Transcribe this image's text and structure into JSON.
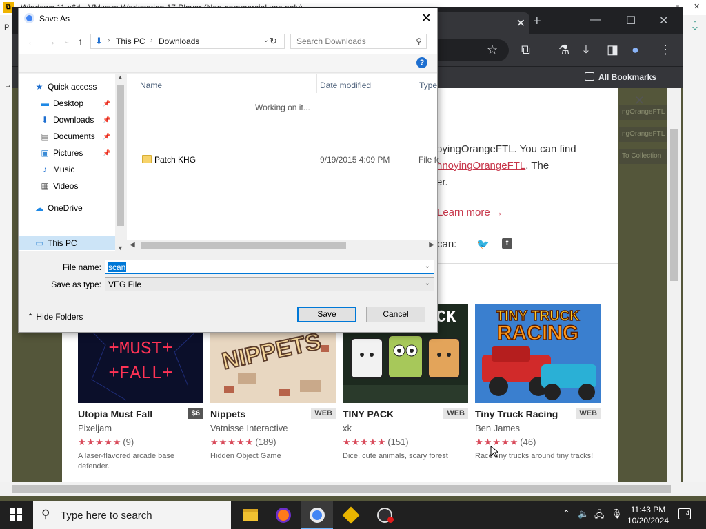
{
  "vm": {
    "title": "Windows 11 x64 - VMware Workstation 17 Player (Non-commercial use only)"
  },
  "browser": {
    "tab_label": "h",
    "bookmarks_label": "All Bookmarks",
    "side_tags": [
      "ngOrangeFTL",
      "ngOrangeFTL",
      "To Collection"
    ]
  },
  "page": {
    "popup_lines": [
      "oyingOrangeFTL. You can find",
      "nnoyingOrangeFTL",
      ". The",
      "er."
    ],
    "learn_more": "Learn more →",
    "share_label": "can:"
  },
  "games": [
    {
      "title": "Utopia Must Fall",
      "badge": "$6",
      "author": "Pixeljam",
      "stars": "★★★★★",
      "count": "(9)",
      "desc": "A laser-flavored arcade base defender."
    },
    {
      "title": "Nippets",
      "badge": "WEB",
      "author": "Vatnisse Interactive",
      "stars": "★★★★★",
      "count": "(189)",
      "desc": "Hidden Object Game"
    },
    {
      "title": "TINY PACK",
      "badge": "WEB",
      "author": "xk",
      "stars": "★★★★★",
      "count": "(151)",
      "desc": "Dice, cute animals, scary forest"
    },
    {
      "title": "Tiny Truck Racing",
      "badge": "WEB",
      "author": "Ben James",
      "stars": "★★★★★",
      "count": "(46)",
      "desc": "Race tiny trucks around tiny tracks!"
    }
  ],
  "thumb_text": {
    "utopia": [
      "+MUST+",
      "+FALL+"
    ],
    "nippets": "NIPPETS",
    "tinypack": "CK",
    "truck": [
      "TINY TRUCK",
      "RACING"
    ]
  },
  "dialog": {
    "title": "Save As",
    "breadcrumb": [
      "This PC",
      "Downloads"
    ],
    "search_placeholder": "Search Downloads",
    "help": "?",
    "nav_items": [
      {
        "label": "Quick access",
        "icon": "star-icon"
      },
      {
        "label": "Desktop",
        "icon": "desktop-icon"
      },
      {
        "label": "Downloads",
        "icon": "download-icon"
      },
      {
        "label": "Documents",
        "icon": "documents-icon"
      },
      {
        "label": "Pictures",
        "icon": "pictures-icon"
      },
      {
        "label": "Music",
        "icon": "music-icon"
      },
      {
        "label": "Videos",
        "icon": "videos-icon"
      },
      {
        "label": "OneDrive",
        "icon": "cloud-icon"
      },
      {
        "label": "This PC",
        "icon": "computer-icon"
      }
    ],
    "columns": [
      "Name",
      "Date modified",
      "Type"
    ],
    "working_text": "Working on it...",
    "files": [
      {
        "name": "Patch KHG",
        "date": "9/19/2015 4:09 PM",
        "type": "File fo"
      }
    ],
    "file_name_label": "File name:",
    "file_name_value": "scan",
    "save_type_label": "Save as type:",
    "save_type_value": "VEG File",
    "hide_folders": "Hide Folders",
    "save_button": "Save",
    "cancel_button": "Cancel"
  },
  "taskbar": {
    "search_placeholder": "Type here to search",
    "time": "11:43 PM",
    "date": "10/20/2024",
    "notifications": "4"
  },
  "colors": {
    "accent": "#0078d7",
    "link": "#c7364a",
    "star": "#d84a5a"
  }
}
